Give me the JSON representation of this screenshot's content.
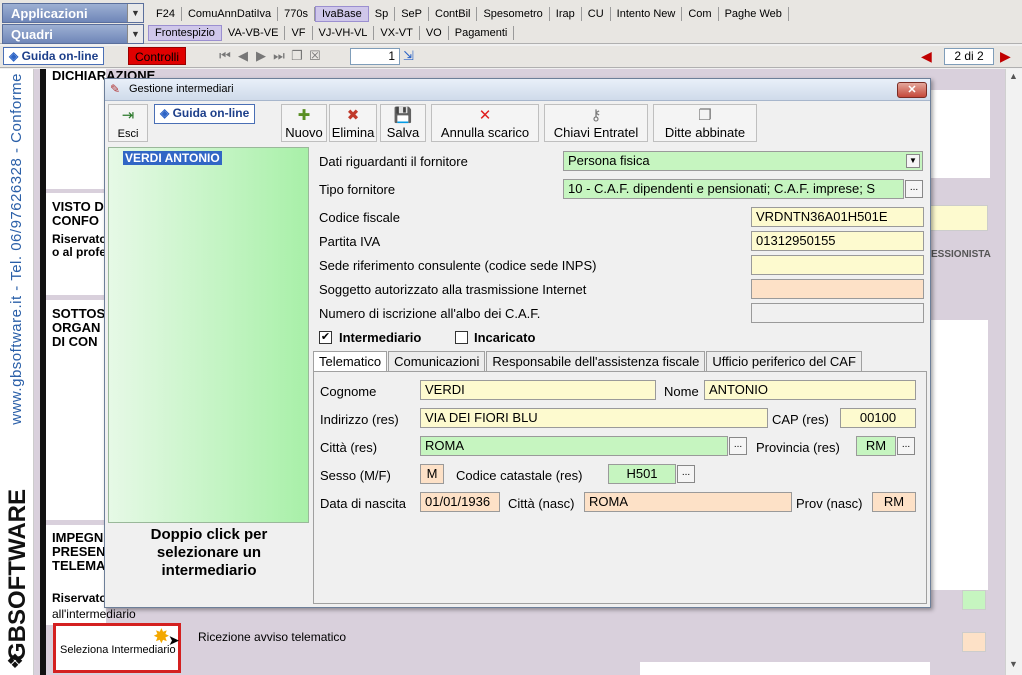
{
  "topbar": {
    "combo1": "Applicazioni",
    "combo2": "Quadri",
    "menu1": [
      "F24",
      "ComuAnnDatiIva",
      "770s",
      "IvaBase",
      "Sp",
      "SeP",
      "ContBil",
      "Spesometro",
      "Irap",
      "CU",
      "Intento New",
      "Com",
      "Paghe Web"
    ],
    "menu2": [
      "Frontespizio",
      "VA-VB-VE",
      "VF",
      "VJ-VH-VL",
      "VX-VT",
      "VO",
      "Pagamenti"
    ]
  },
  "navbar": {
    "guida": "Guida on-line",
    "controlli": "Controlli",
    "page_value": "1",
    "page_of": "2 di 2"
  },
  "sidebar": {
    "vertical_text": "www.gbsoftware.it - Tel. 06/97626328 - Conforme",
    "logo": "GBSOFTWARE"
  },
  "background": {
    "s1": "DICHIARAZIONE",
    "s2a": "VISTO D",
    "s2b": "CONFO",
    "s2c": "Riservato",
    "s2d": "o al profe",
    "s2e": "ESSIONISTA",
    "s3a": "SOTTOS",
    "s3b": "ORGAN",
    "s3c": "DI CON",
    "s4a": "IMPEGN",
    "s4b": "PRESEN",
    "s4c": "TELEMA",
    "s4d": "Riservato",
    "s4e": "all'intermediario",
    "sel_button": "Seleziona Intermediario",
    "ricezione": "Ricezione avviso telematico"
  },
  "dialog": {
    "title": "Gestione intermediari",
    "toolbar": {
      "esci": "Esci",
      "guida": "Guida on-line",
      "nuovo": "Nuovo",
      "elimina": "Elimina",
      "salva": "Salva",
      "annulla": "Annulla scarico",
      "chiavi": "Chiavi Entratel",
      "ditte": "Ditte abbinate"
    },
    "list_items": [
      "VERDI ANTONIO"
    ],
    "hint": "Doppio click per selezionare un intermediario",
    "form": {
      "dati_label": "Dati riguardanti il fornitore",
      "dati_value": "Persona fisica",
      "tipo_label": "Tipo fornitore",
      "tipo_value": "10 - C.A.F. dipendenti e pensionati; C.A.F. imprese; S",
      "cf_label": "Codice fiscale",
      "cf_value": "VRDNTN36A01H501E",
      "piva_label": "Partita IVA",
      "piva_value": "01312950155",
      "sede_label": "Sede riferimento consulente (codice sede INPS)",
      "sede_value": "",
      "sogg_label": "Soggetto autorizzato alla trasmissione Internet",
      "sogg_value": "",
      "num_label": "Numero di iscrizione all'albo dei C.A.F.",
      "num_value": "",
      "intermediario_label": "Intermediario",
      "intermediario_checked": true,
      "incaricato_label": "Incaricato",
      "incaricato_checked": false
    },
    "tabs": [
      "Telematico",
      "Comunicazioni",
      "Responsabile dell'assistenza fiscale",
      "Ufficio periferico del CAF"
    ],
    "telematico": {
      "cognome_label": "Cognome",
      "cognome_value": "VERDI",
      "nome_label": "Nome",
      "nome_value": "ANTONIO",
      "indirizzo_label": "Indirizzo (res)",
      "indirizzo_value": "VIA DEI FIORI BLU",
      "cap_label": "CAP (res)",
      "cap_value": "00100",
      "citta_label": "Città (res)",
      "citta_value": "ROMA",
      "provincia_label": "Provincia (res)",
      "provincia_value": "RM",
      "sesso_label": "Sesso (M/F)",
      "sesso_value": "M",
      "catastale_label": "Codice catastale (res)",
      "catastale_value": "H501",
      "nascita_label": "Data di nascita",
      "nascita_value": "01/01/1936",
      "citta_nasc_label": "Città (nasc)",
      "citta_nasc_value": "ROMA",
      "prov_nasc_label": "Prov (nasc)",
      "prov_nasc_value": "RM"
    }
  }
}
